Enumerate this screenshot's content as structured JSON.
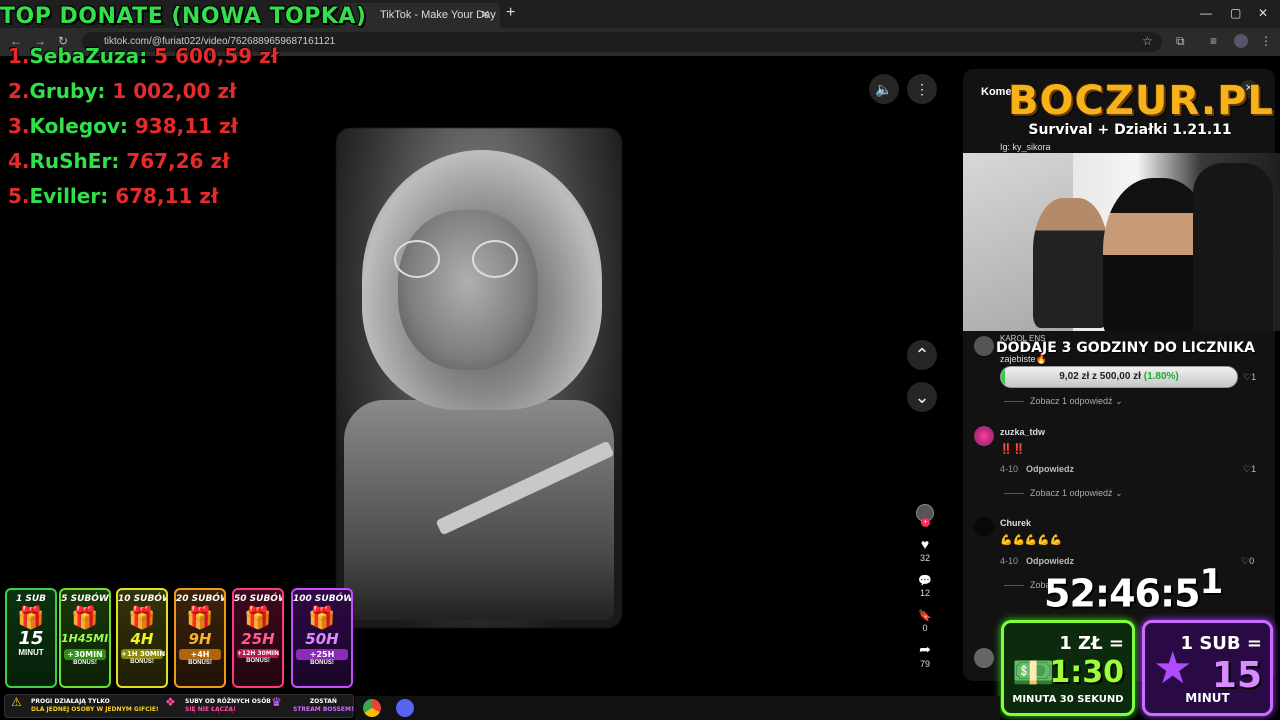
{
  "browser": {
    "tab_title": "TikTok - Make Your Day",
    "tab_close": "✕",
    "new_tab": "+",
    "url": "tiktok.com/@furiat022/video/7626889659687161121",
    "win_min": "—",
    "win_max": "▢",
    "win_close": "✕"
  },
  "overlay_donate": {
    "title": "TOP DONATE (NOWA TOPKA)",
    "donors": [
      {
        "rank": "1.",
        "name": "SebaZuza",
        "amount": "5 600,59 zł"
      },
      {
        "rank": "2.",
        "name": "Gruby",
        "amount": "1 002,00 zł"
      },
      {
        "rank": "3.",
        "name": "Kolegov",
        "amount": "938,11 zł"
      },
      {
        "rank": "4.",
        "name": "RuShEr",
        "amount": "767,26 zł"
      },
      {
        "rank": "5.",
        "name": "Eviller",
        "amount": "678,11 zł"
      }
    ]
  },
  "video": {
    "mute_icon": "🔈",
    "more_icon": "⋮",
    "up_icon": "⌃",
    "down_icon": "⌄",
    "actions": [
      {
        "icon": "♥",
        "count": "32"
      },
      {
        "icon": "💬",
        "count": "12"
      },
      {
        "icon": "🔖",
        "count": "0"
      },
      {
        "icon": "➦",
        "count": "79"
      }
    ]
  },
  "comments_panel": {
    "tab_label": "Komen",
    "close_icon": "✕",
    "ig_label": "Ig: ky_sikora",
    "overlay_logo": "BOCZUR.PL",
    "overlay_logo_sub": "Survival + Działki 1.21.11",
    "first_commenter": "KAROL ENS",
    "first_comment": "zajebiste🔥",
    "subs_goal_title": "DODAJE 3 GODZINY DO LICZNIKA",
    "goal": {
      "label": "9,02 zł z 500,00 zł",
      "percent_text": "(1.80%)",
      "fraction": 0.018
    },
    "first_likes": "1",
    "see_replies_1": "Zobacz 1 odpowiedź",
    "comment2": {
      "user": "zuzka_tdw",
      "text": "‼️‼️",
      "date": "4-10",
      "reply": "Odpowiedz",
      "likes": "1"
    },
    "see_replies_2": "Zobacz 1 odpowiedź",
    "comment3": {
      "user": "Churek",
      "text": "💪💪💪💪💪",
      "date": "4-10",
      "reply": "Odpowiedz",
      "likes": "0"
    },
    "see_replies_3": "Zobac",
    "timer": "52:46:5",
    "timer_tail": "1"
  },
  "price_cards": [
    {
      "top": "1 ZŁ =",
      "big": "1:30",
      "sub": "MINUTA 30 SEKUND",
      "icon": "💵",
      "color": "#7fff3a"
    },
    {
      "top": "1 SUB =",
      "big": "15",
      "sub": "MINUT",
      "icon": "★",
      "color": "#c96cff"
    }
  ],
  "sub_cards": [
    {
      "label": "1 SUB",
      "value": "15",
      "unit": "MINUT",
      "bonus": "",
      "color": "#3bd14a"
    },
    {
      "label": "5 SUBÓW",
      "value": "1H45MIN",
      "unit": "",
      "bonus": "+30MIN",
      "color": "#6de02a"
    },
    {
      "label": "10 SUBÓW",
      "value": "4H",
      "unit": "",
      "bonus": "+1H 30MIN",
      "color": "#e3e21a"
    },
    {
      "label": "20 SUBÓW",
      "value": "9H",
      "unit": "",
      "bonus": "+4H",
      "color": "#f39a1a"
    },
    {
      "label": "50 SUBÓW",
      "value": "25H",
      "unit": "",
      "bonus": "+12H 30MIN",
      "color": "#ff3a7a"
    },
    {
      "label": "100 SUBÓW",
      "value": "50H",
      "unit": "",
      "bonus": "+25H",
      "color": "#c94cff"
    }
  ],
  "bonus_tag": "BONUS!",
  "info_bar": {
    "i1_a": "PROGI DZIAŁAJĄ TYLKO",
    "i1_b": "DLA JEDNEJ OSOBY W JEDNYM GIFCIE!",
    "i2_a": "SUBY OD RÓŻNYCH OSÓB",
    "i2_b": "SIĘ NIE ŁĄCZĄ!",
    "i3_a": "ZOSTAŃ",
    "i3_b": "STREAM BOSSEM!"
  }
}
